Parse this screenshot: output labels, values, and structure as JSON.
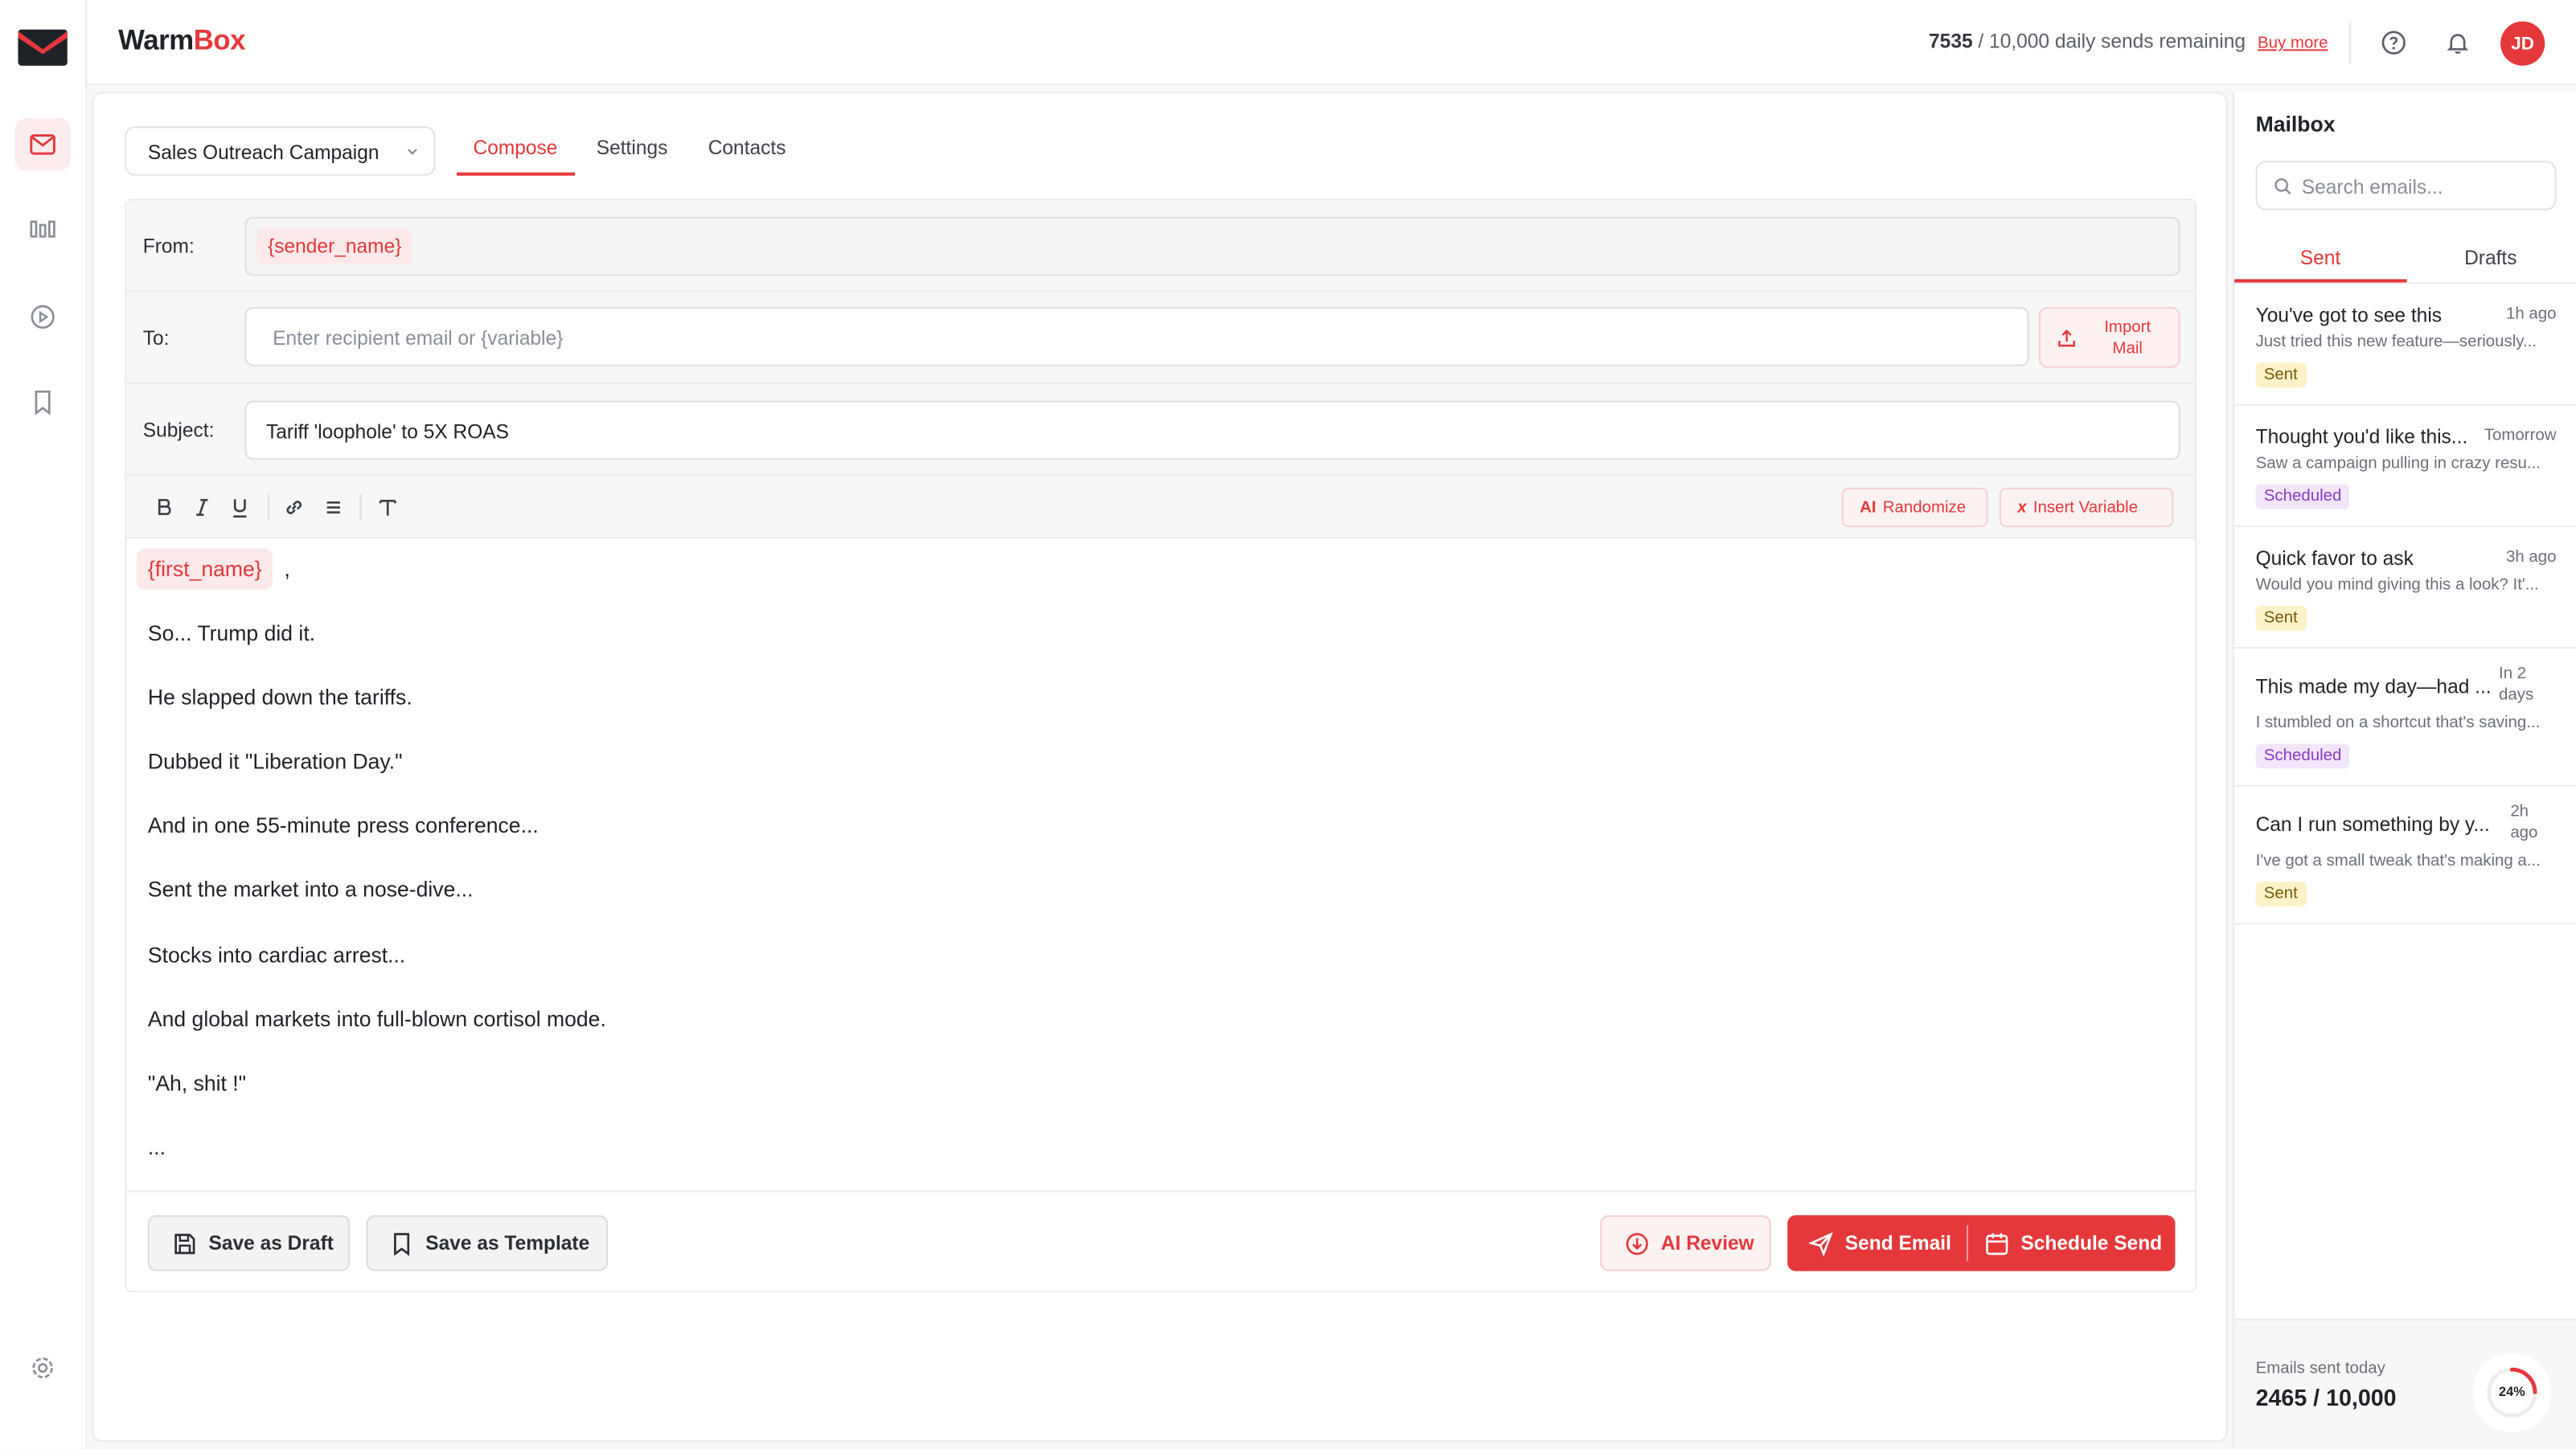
{
  "app": {
    "brand_part1": "Warm",
    "brand_part2": "Box"
  },
  "header": {
    "sends_count": "7535",
    "sends_text": " / 10,000 daily sends remaining",
    "buy_more": "Buy more",
    "avatar_initials": "JD"
  },
  "rail": {
    "items": [
      "mail-icon",
      "chart-icon",
      "play-icon",
      "bookmark-icon",
      "gear-icon"
    ]
  },
  "campaign": {
    "selected": "Sales Outreach Campaign",
    "tabs": [
      "Compose",
      "Settings",
      "Contacts"
    ]
  },
  "compose": {
    "from_label": "From:",
    "from_chip": "{sender_name}",
    "to_label": "To:",
    "to_placeholder": "Enter recipient email or {variable}",
    "import_label": "Import Mail",
    "subject_label": "Subject:",
    "subject_value": "Tariff 'loophole' to 5X ROAS",
    "toolbar": {
      "randomize_prefix": "AI",
      "randomize_label": "Randomize",
      "insert_prefix": "x",
      "insert_label": "Insert Variable"
    },
    "greeting_chip": "{first_name}",
    "greeting_suffix": ",",
    "body": [
      "So... Trump did it.",
      "He slapped down the tariffs.",
      "Dubbed it \"Liberation Day.\"",
      "And in one 55-minute press conference...",
      "Sent the market into a nose-dive...",
      "Stocks into cardiac arrest...",
      "And global markets into full-blown cortisol mode.",
      "\"Ah, shit !\"",
      "..."
    ],
    "buttons": {
      "save_draft": "Save as Draft",
      "save_template": "Save as Template",
      "ai_review": "AI Review",
      "send_email": "Send Email",
      "schedule_send": "Schedule Send"
    }
  },
  "mailbox": {
    "title": "Mailbox",
    "search_placeholder": "Search emails...",
    "tabs": [
      "Sent",
      "Drafts"
    ],
    "items": [
      {
        "subject": "You've got to see this",
        "time": "1h ago",
        "preview": "Just tried this new feature—seriously...",
        "status": "Sent"
      },
      {
        "subject": "Thought you'd like this...",
        "time": "Tomorrow",
        "preview": "Saw a campaign pulling in crazy resu...",
        "status": "Scheduled"
      },
      {
        "subject": "Quick favor to ask",
        "time": "3h ago",
        "preview": "Would you mind giving this a look? It'...",
        "status": "Sent"
      },
      {
        "subject": "This made my day—had ...",
        "time": "In 2 days",
        "preview": "I stumbled on a shortcut that's saving...",
        "status": "Scheduled"
      },
      {
        "subject": "Can I run something by y...",
        "time": "2h ago",
        "preview": "I've got a small tweak that's making a...",
        "status": "Sent"
      }
    ],
    "sent_today_label": "Emails sent today",
    "sent_today_value": "2465 / 10,000",
    "sent_today_percent": "24%",
    "sent_today_fraction": 0.2465
  },
  "colors": {
    "accent": "#e5383b",
    "sent_badge": "#fdf2c8",
    "scheduled_badge": "#f2e6fb"
  }
}
